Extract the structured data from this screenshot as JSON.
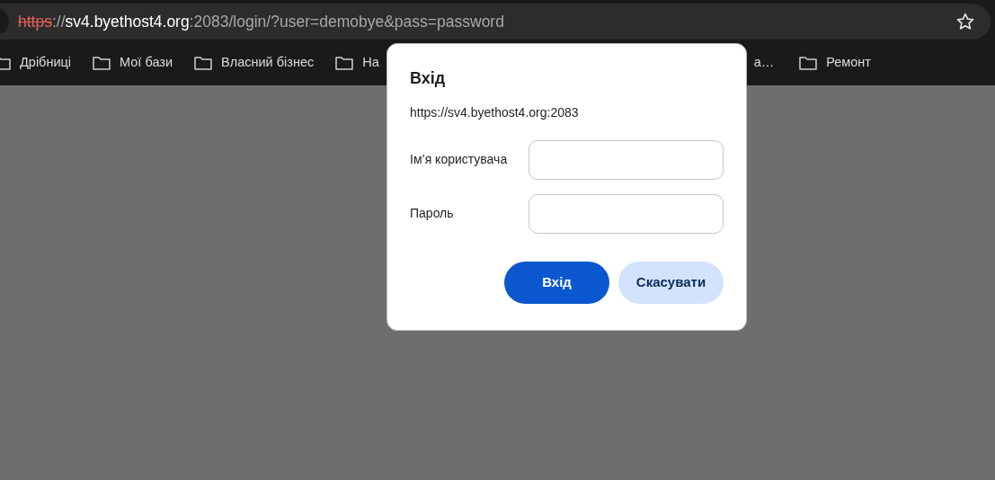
{
  "address_bar": {
    "url_parts": [
      {
        "kind": "scheme",
        "text": "https"
      },
      {
        "kind": "dim",
        "text": "://"
      },
      {
        "kind": "host",
        "text": "sv4.byethost4.org"
      },
      {
        "kind": "dim",
        "text": ":2083/login/?user=demobye&pass=password"
      }
    ]
  },
  "bookmarks": [
    {
      "label": "Дрібниці",
      "kind": "folder"
    },
    {
      "label": "Мої бази",
      "kind": "folder"
    },
    {
      "label": "Власний бізнес",
      "kind": "folder"
    },
    {
      "label": "На",
      "kind": "folder"
    },
    {
      "label": "а…",
      "kind": "partial"
    },
    {
      "label": "Ремонт",
      "kind": "folder"
    }
  ],
  "dialog": {
    "title": "Вхід",
    "origin": "https://sv4.byethost4.org:2083",
    "fields": [
      {
        "label": "Ім’я користувача"
      },
      {
        "label": "Пароль"
      }
    ],
    "buttons": [
      {
        "label": "Вхід",
        "kind": "primary"
      },
      {
        "label": "Скасувати",
        "kind": "secondary"
      }
    ]
  }
}
